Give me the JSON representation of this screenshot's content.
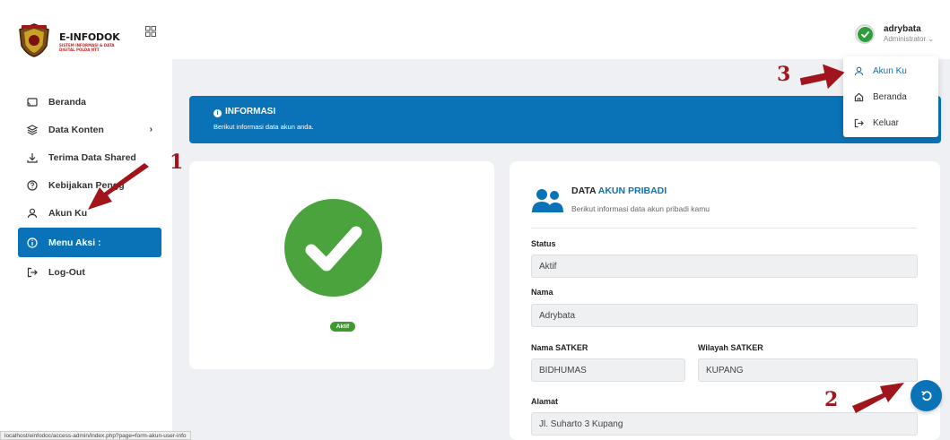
{
  "brand": {
    "title": "E-INFODOK",
    "subtitle": "SISTEM INFORMASI & DATA DIGITAL POLDA NTT"
  },
  "sidebar": {
    "items": [
      {
        "label": "Beranda",
        "icon": "cast-icon"
      },
      {
        "label": "Data Konten",
        "icon": "layers-icon",
        "chevron": "›"
      },
      {
        "label": "Terima Data Shared",
        "icon": "download-icon"
      },
      {
        "label": "Kebijakan Pengg",
        "icon": "help-circle-icon"
      },
      {
        "label": "Akun Ku",
        "icon": "user-icon"
      },
      {
        "label": "Menu Aksi :",
        "icon": "info-icon",
        "active": true
      },
      {
        "label": "Log-Out",
        "icon": "logout-icon"
      }
    ]
  },
  "user": {
    "name": "adrybata",
    "role": "Administrator",
    "role_caret": "⌄"
  },
  "dropdown": {
    "items": [
      {
        "label": "Akun Ku",
        "icon": "user-icon",
        "selected": true
      },
      {
        "label": "Beranda",
        "icon": "home-icon"
      },
      {
        "label": "Keluar",
        "icon": "logout-icon"
      }
    ]
  },
  "banner": {
    "title": "INFORMASI",
    "text": "Berikut informasi data akun anda."
  },
  "status_card": {
    "badge": "Aktif"
  },
  "account": {
    "title_plain": "DATA",
    "title_accent": "AKUN PRIBADI",
    "subtitle": "Berikut informasi data akun pribadi kamu",
    "fields": {
      "status": {
        "label": "Status",
        "value": "Aktif"
      },
      "nama": {
        "label": "Nama",
        "value": "Adrybata"
      },
      "satker": {
        "label": "Nama SATKER",
        "value": "BIDHUMAS"
      },
      "wilayah": {
        "label": "Wilayah SATKER",
        "value": "KUPANG"
      },
      "alamat": {
        "label": "Alamat",
        "value": "Jl. Suharto 3 Kupang"
      }
    }
  },
  "status_url": "localhost/einfodoc/access-admin/index.php?page=form-akun-user-info",
  "annotations": [
    "1",
    "2",
    "3"
  ],
  "colors": {
    "primary": "#0a73b8",
    "success": "#4aa33c",
    "annotation": "#a0141b"
  }
}
